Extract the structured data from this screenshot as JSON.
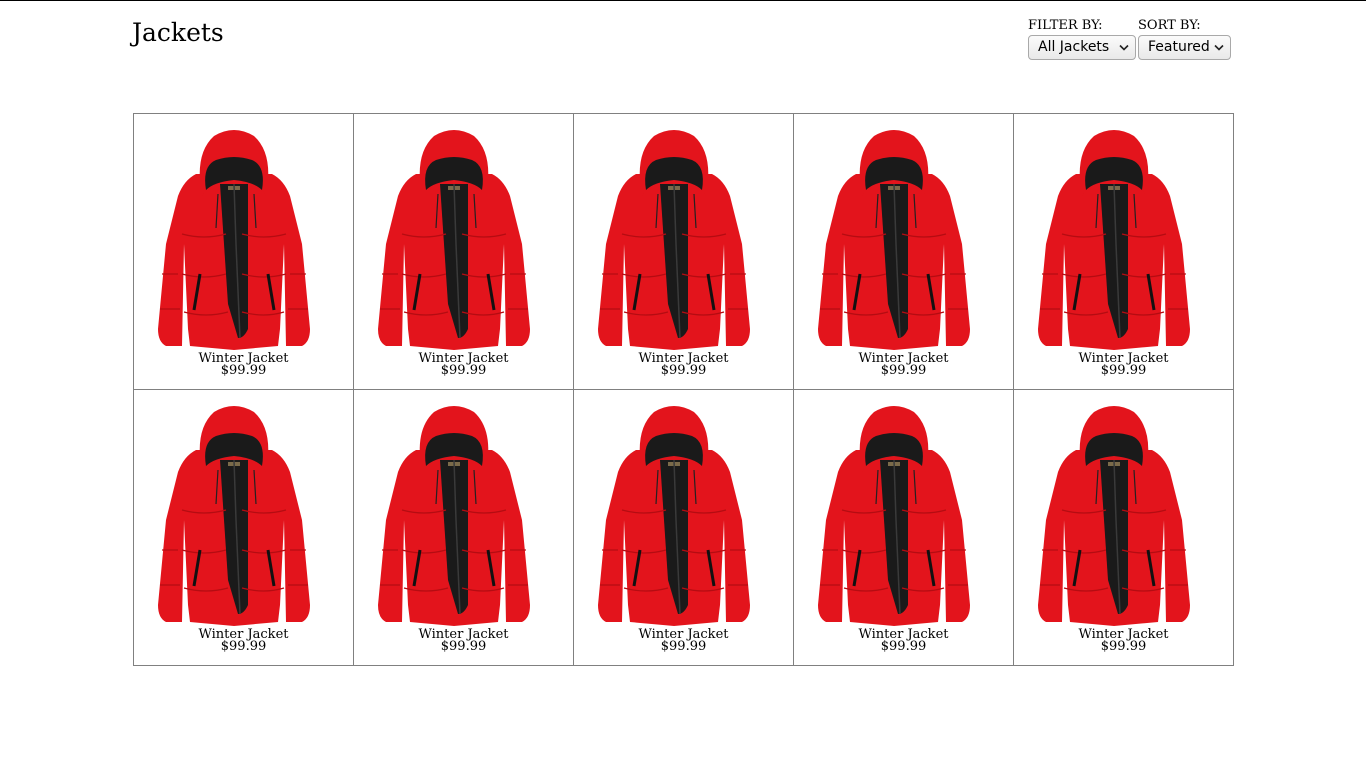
{
  "page": {
    "title": "Jackets"
  },
  "filter": {
    "label": "FILTER BY:",
    "selected": "All Jackets"
  },
  "sort": {
    "label": "SORT BY:",
    "selected": "Featured"
  },
  "products": [
    {
      "name": "Winter Jacket",
      "price": "$99.99",
      "image": "red-puffer-jacket"
    },
    {
      "name": "Winter Jacket",
      "price": "$99.99",
      "image": "red-puffer-jacket"
    },
    {
      "name": "Winter Jacket",
      "price": "$99.99",
      "image": "red-puffer-jacket"
    },
    {
      "name": "Winter Jacket",
      "price": "$99.99",
      "image": "red-puffer-jacket"
    },
    {
      "name": "Winter Jacket",
      "price": "$99.99",
      "image": "red-puffer-jacket"
    },
    {
      "name": "Winter Jacket",
      "price": "$99.99",
      "image": "red-puffer-jacket"
    },
    {
      "name": "Winter Jacket",
      "price": "$99.99",
      "image": "red-puffer-jacket"
    },
    {
      "name": "Winter Jacket",
      "price": "$99.99",
      "image": "red-puffer-jacket"
    },
    {
      "name": "Winter Jacket",
      "price": "$99.99",
      "image": "red-puffer-jacket"
    },
    {
      "name": "Winter Jacket",
      "price": "$99.99",
      "image": "red-puffer-jacket"
    }
  ],
  "colors": {
    "jacket_red": "#e3141c",
    "jacket_shadow": "#b50c12",
    "lining_black": "#1a1a1a",
    "card_border": "#808080"
  }
}
